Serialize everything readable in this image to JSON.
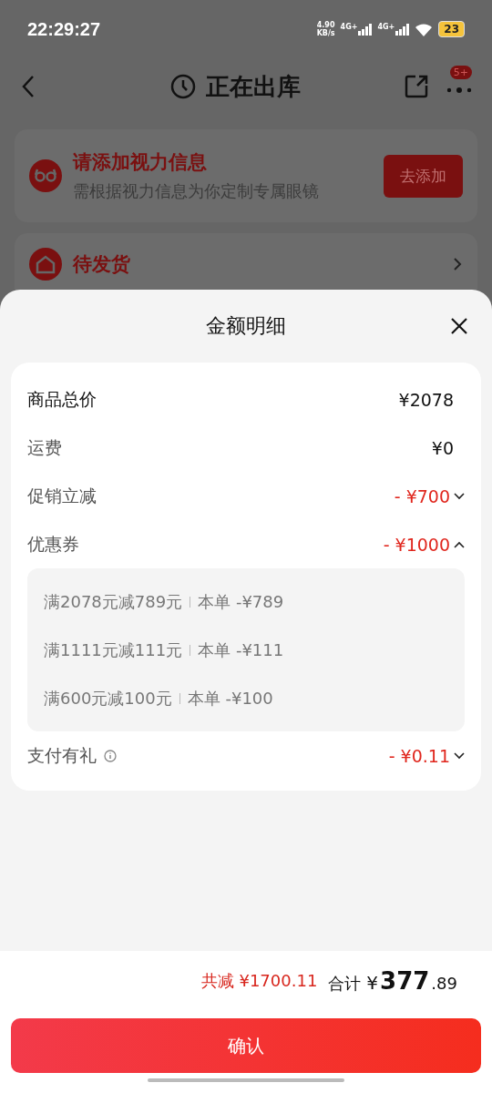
{
  "status_bar": {
    "time": "22:29:27",
    "speed_value": "4.90",
    "speed_unit": "KB/s",
    "networks": [
      "4G+",
      "4G+"
    ],
    "battery": "23"
  },
  "header": {
    "title": "正在出库",
    "badge": "5+"
  },
  "vision_card": {
    "title": "请添加视力信息",
    "subtitle": "需根据视力信息为你定制专属眼镜",
    "button": "去添加"
  },
  "status_card": {
    "title": "待发货"
  },
  "sheet": {
    "title": "金额明细",
    "rows": [
      {
        "kind": "plain",
        "label": "商品总价",
        "value": "¥2078",
        "strong": true
      },
      {
        "kind": "plain",
        "label": "运费",
        "value": "¥0",
        "strong": false
      },
      {
        "kind": "discount",
        "label": "促销立减",
        "value": "- ¥700",
        "expanded": false,
        "info": false
      },
      {
        "kind": "discount",
        "label": "优惠券",
        "value": "- ¥1000",
        "expanded": true,
        "info": false,
        "coupons": [
          {
            "rule": "满2078元减789元",
            "applied": "本单 -¥789"
          },
          {
            "rule": "满1111元减111元",
            "applied": "本单 -¥111"
          },
          {
            "rule": "满600元减100元",
            "applied": "本单 -¥100"
          }
        ]
      },
      {
        "kind": "discount",
        "label": "支付有礼",
        "value": "- ¥0.11",
        "expanded": false,
        "info": true
      }
    ]
  },
  "footer": {
    "saved": "共减 ¥1700.11",
    "total_label": "合计",
    "currency": "¥",
    "integer": "377",
    "decimal": ".89",
    "confirm": "确认"
  }
}
